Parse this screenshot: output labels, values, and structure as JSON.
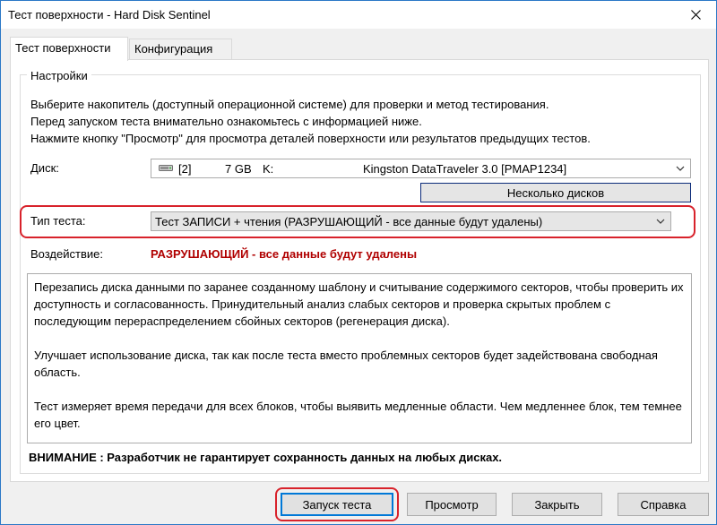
{
  "window": {
    "title": "Тест поверхности - Hard Disk Sentinel"
  },
  "tabs": [
    {
      "label": "Тест поверхности",
      "active": true
    },
    {
      "label": "Конфигурация",
      "active": false
    }
  ],
  "settings": {
    "group_label": "Настройки",
    "intro_lines": [
      "Выберите накопитель (доступный операционной системе) для проверки и метод тестирования.",
      "Перед запуском теста внимательно ознакомьтесь с информацией ниже.",
      "Нажмите кнопку \"Просмотр\" для просмотра деталей поверхности или результатов предыдущих тестов."
    ],
    "disk_label": "Диск:",
    "disk": {
      "index": "[2]",
      "size": "7 GB",
      "drive": "K:",
      "model": "Kingston DataTraveler 3.0 [PMAP1234]"
    },
    "multi_disk_button": "Несколько дисков",
    "test_type_label": "Тип теста:",
    "test_type_value": "Тест ЗАПИСИ + чтения (РАЗРУШАЮЩИЙ - все данные будут удалены)",
    "impact_label": "Воздействие:",
    "impact_value": "РАЗРУШАЮЩИЙ - все данные будут удалены",
    "description": [
      "Перезапись диска данными по заранее созданному шаблону и считывание содержимого секторов, чтобы проверить их доступность и согласованность. Принудительный анализ слабых секторов и проверка скрытых проблем с последующим перераспределением сбойных секторов (регенерация диска).",
      "Улучшает использование диска, так как после теста вместо проблемных секторов будет задействована свободная область.",
      "Тест измеряет время передачи для всех блоков, чтобы выявить медленные области. Чем медленнее блок, тем темнее его цвет."
    ],
    "warning": "ВНИМАНИЕ : Разработчик не гарантирует сохранность данных на любых дисках."
  },
  "buttons": {
    "run": "Запуск теста",
    "view": "Просмотр",
    "close": "Закрыть",
    "help": "Справка"
  },
  "colors": {
    "highlight": "#d8222b",
    "impact_text": "#b00000",
    "focus_border": "#0078d7"
  }
}
